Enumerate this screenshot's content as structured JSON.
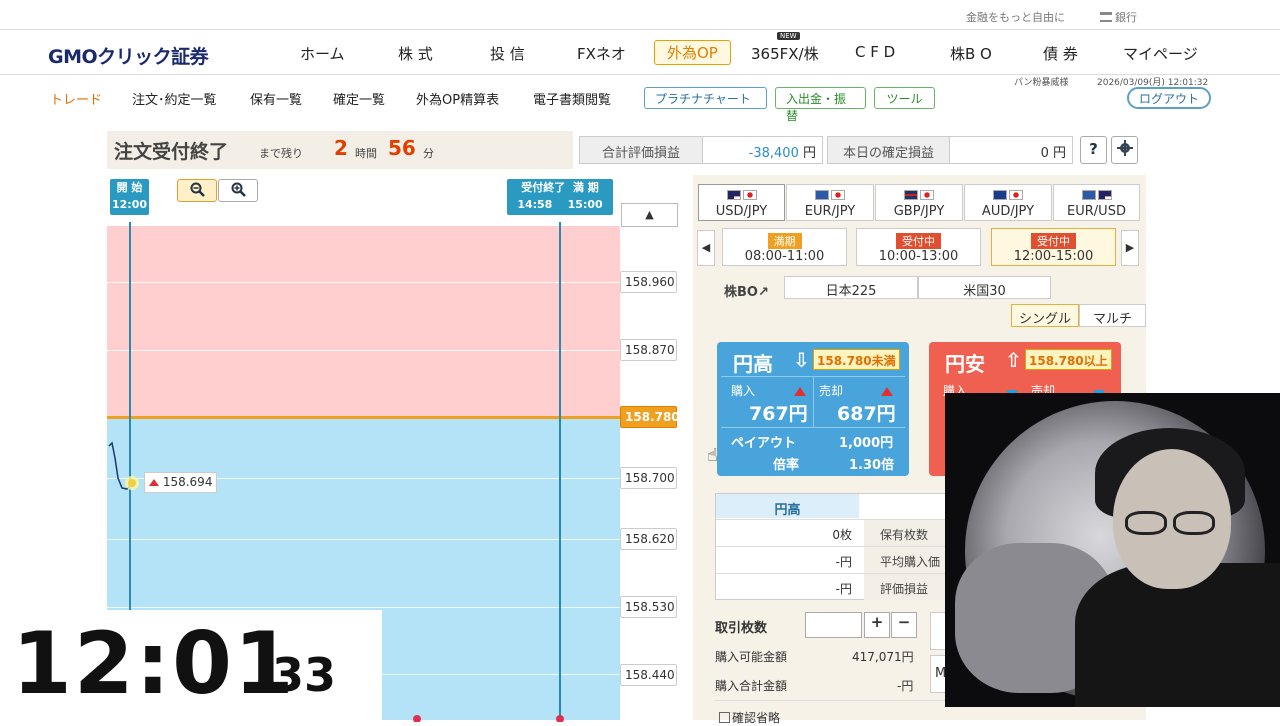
{
  "util": {
    "link1": "金融をもっと自由に",
    "link2": "銀行"
  },
  "header": {
    "logo": "GMOクリック証券",
    "nav": [
      "ホーム",
      "株 式",
      "投 信",
      "FXネオ",
      "外為OP",
      "365FX/株",
      "C F D",
      "株B O",
      "債 券",
      "マイページ"
    ],
    "new_badge": "NEW"
  },
  "subnav": {
    "items": [
      "トレード",
      "注文･約定一覧",
      "保有一覧",
      "確定一覧",
      "外為OP精算表",
      "電子書類閲覧"
    ],
    "buttons": [
      "プラチナチャート",
      "入出金・振替",
      "ツール"
    ],
    "user": "パン粉暴威様",
    "datetime": "2026/03/09(月) 12:01:32",
    "logout": "ログアウト"
  },
  "status": {
    "title": "注文受付終了",
    "remaining_label": "まで残り",
    "hours": "2",
    "hours_unit": "時間",
    "minutes": "56",
    "minutes_unit": "分",
    "total_pl_label": "合計評価損益",
    "total_pl_value": "-38,400",
    "yen": "円",
    "today_pl_label": "本日の確定損益",
    "today_pl_value": "0",
    "help": "?",
    "settings_icon": "gear-icon"
  },
  "chart": {
    "start_label": "開 始",
    "start_time": "12:00",
    "close_label": "受付終了",
    "close_time": "14:58",
    "expiry_label": "満 期",
    "expiry_time": "15:00",
    "y_ticks": [
      "158.960",
      "158.870",
      "158.780",
      "158.700",
      "158.620",
      "158.530",
      "158.440"
    ],
    "current_strike": "158.780",
    "current_price": "158.694",
    "zoom_out_icon": "zoom-out-icon",
    "zoom_in_icon": "zoom-in-icon",
    "colors": {
      "above": "#ffcfd0",
      "below": "#b4e3f8",
      "strike": "#f0a020"
    }
  },
  "clock": {
    "hm": "12:01",
    "s": "33"
  },
  "pairs": [
    "USD/JPY",
    "EUR/JPY",
    "GBP/JPY",
    "AUD/JPY",
    "EUR/USD"
  ],
  "sessions": [
    {
      "badge": "満期",
      "time": "08:00-11:00",
      "color": "#f0a020"
    },
    {
      "badge": "受付中",
      "time": "10:00-13:00",
      "color": "#e05030"
    },
    {
      "badge": "受付中",
      "time": "12:00-15:00",
      "color": "#e05030"
    }
  ],
  "kabubo": {
    "label": "株BO↗",
    "b1": "日本225",
    "b2": "米国30"
  },
  "mode": {
    "single": "シングル",
    "multi": "マルチ"
  },
  "cards": {
    "high": {
      "title": "円高",
      "cond": "158.780未満",
      "buy_label": "購入",
      "sell_label": "売却",
      "buy": "767円",
      "sell": "687円",
      "payout_label": "ペイアウト",
      "payout": "1,000円",
      "rate_label": "倍率",
      "rate": "1.30倍"
    },
    "low": {
      "title": "円安",
      "cond": "158.780以上",
      "buy_label": "購入",
      "sell_label": "売却"
    }
  },
  "positions": {
    "header": "円高",
    "rows": [
      {
        "value": "0枚",
        "label": "保有枚数"
      },
      {
        "value": "-円",
        "label": "平均購入価"
      },
      {
        "value": "-円",
        "label": "評価損益"
      }
    ]
  },
  "order": {
    "qty_label": "取引枚数",
    "plus": "+",
    "minus": "−",
    "avail_label": "購入可能金額",
    "avail_value": "417,071円",
    "total_label": "購入合計金額",
    "total_value": "-円",
    "skip_confirm": "確認省略"
  }
}
